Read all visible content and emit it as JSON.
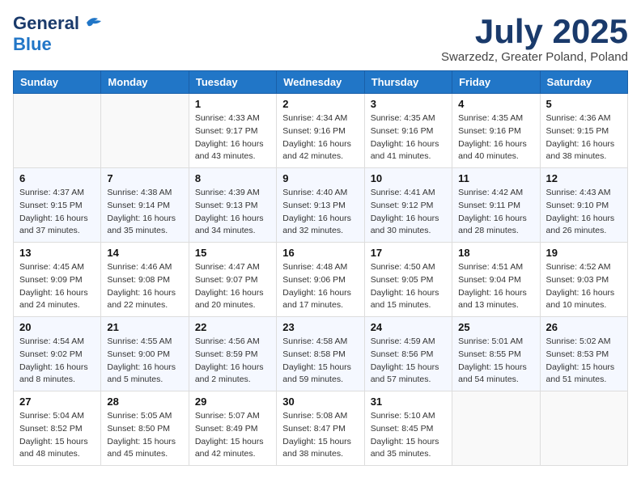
{
  "header": {
    "logo_general": "General",
    "logo_blue": "Blue",
    "month_title": "July 2025",
    "subtitle": "Swarzedz, Greater Poland, Poland"
  },
  "days_of_week": [
    "Sunday",
    "Monday",
    "Tuesday",
    "Wednesday",
    "Thursday",
    "Friday",
    "Saturday"
  ],
  "weeks": [
    [
      {
        "day": "",
        "info": ""
      },
      {
        "day": "",
        "info": ""
      },
      {
        "day": "1",
        "info": "Sunrise: 4:33 AM\nSunset: 9:17 PM\nDaylight: 16 hours and 43 minutes."
      },
      {
        "day": "2",
        "info": "Sunrise: 4:34 AM\nSunset: 9:16 PM\nDaylight: 16 hours and 42 minutes."
      },
      {
        "day": "3",
        "info": "Sunrise: 4:35 AM\nSunset: 9:16 PM\nDaylight: 16 hours and 41 minutes."
      },
      {
        "day": "4",
        "info": "Sunrise: 4:35 AM\nSunset: 9:16 PM\nDaylight: 16 hours and 40 minutes."
      },
      {
        "day": "5",
        "info": "Sunrise: 4:36 AM\nSunset: 9:15 PM\nDaylight: 16 hours and 38 minutes."
      }
    ],
    [
      {
        "day": "6",
        "info": "Sunrise: 4:37 AM\nSunset: 9:15 PM\nDaylight: 16 hours and 37 minutes."
      },
      {
        "day": "7",
        "info": "Sunrise: 4:38 AM\nSunset: 9:14 PM\nDaylight: 16 hours and 35 minutes."
      },
      {
        "day": "8",
        "info": "Sunrise: 4:39 AM\nSunset: 9:13 PM\nDaylight: 16 hours and 34 minutes."
      },
      {
        "day": "9",
        "info": "Sunrise: 4:40 AM\nSunset: 9:13 PM\nDaylight: 16 hours and 32 minutes."
      },
      {
        "day": "10",
        "info": "Sunrise: 4:41 AM\nSunset: 9:12 PM\nDaylight: 16 hours and 30 minutes."
      },
      {
        "day": "11",
        "info": "Sunrise: 4:42 AM\nSunset: 9:11 PM\nDaylight: 16 hours and 28 minutes."
      },
      {
        "day": "12",
        "info": "Sunrise: 4:43 AM\nSunset: 9:10 PM\nDaylight: 16 hours and 26 minutes."
      }
    ],
    [
      {
        "day": "13",
        "info": "Sunrise: 4:45 AM\nSunset: 9:09 PM\nDaylight: 16 hours and 24 minutes."
      },
      {
        "day": "14",
        "info": "Sunrise: 4:46 AM\nSunset: 9:08 PM\nDaylight: 16 hours and 22 minutes."
      },
      {
        "day": "15",
        "info": "Sunrise: 4:47 AM\nSunset: 9:07 PM\nDaylight: 16 hours and 20 minutes."
      },
      {
        "day": "16",
        "info": "Sunrise: 4:48 AM\nSunset: 9:06 PM\nDaylight: 16 hours and 17 minutes."
      },
      {
        "day": "17",
        "info": "Sunrise: 4:50 AM\nSunset: 9:05 PM\nDaylight: 16 hours and 15 minutes."
      },
      {
        "day": "18",
        "info": "Sunrise: 4:51 AM\nSunset: 9:04 PM\nDaylight: 16 hours and 13 minutes."
      },
      {
        "day": "19",
        "info": "Sunrise: 4:52 AM\nSunset: 9:03 PM\nDaylight: 16 hours and 10 minutes."
      }
    ],
    [
      {
        "day": "20",
        "info": "Sunrise: 4:54 AM\nSunset: 9:02 PM\nDaylight: 16 hours and 8 minutes."
      },
      {
        "day": "21",
        "info": "Sunrise: 4:55 AM\nSunset: 9:00 PM\nDaylight: 16 hours and 5 minutes."
      },
      {
        "day": "22",
        "info": "Sunrise: 4:56 AM\nSunset: 8:59 PM\nDaylight: 16 hours and 2 minutes."
      },
      {
        "day": "23",
        "info": "Sunrise: 4:58 AM\nSunset: 8:58 PM\nDaylight: 15 hours and 59 minutes."
      },
      {
        "day": "24",
        "info": "Sunrise: 4:59 AM\nSunset: 8:56 PM\nDaylight: 15 hours and 57 minutes."
      },
      {
        "day": "25",
        "info": "Sunrise: 5:01 AM\nSunset: 8:55 PM\nDaylight: 15 hours and 54 minutes."
      },
      {
        "day": "26",
        "info": "Sunrise: 5:02 AM\nSunset: 8:53 PM\nDaylight: 15 hours and 51 minutes."
      }
    ],
    [
      {
        "day": "27",
        "info": "Sunrise: 5:04 AM\nSunset: 8:52 PM\nDaylight: 15 hours and 48 minutes."
      },
      {
        "day": "28",
        "info": "Sunrise: 5:05 AM\nSunset: 8:50 PM\nDaylight: 15 hours and 45 minutes."
      },
      {
        "day": "29",
        "info": "Sunrise: 5:07 AM\nSunset: 8:49 PM\nDaylight: 15 hours and 42 minutes."
      },
      {
        "day": "30",
        "info": "Sunrise: 5:08 AM\nSunset: 8:47 PM\nDaylight: 15 hours and 38 minutes."
      },
      {
        "day": "31",
        "info": "Sunrise: 5:10 AM\nSunset: 8:45 PM\nDaylight: 15 hours and 35 minutes."
      },
      {
        "day": "",
        "info": ""
      },
      {
        "day": "",
        "info": ""
      }
    ]
  ]
}
